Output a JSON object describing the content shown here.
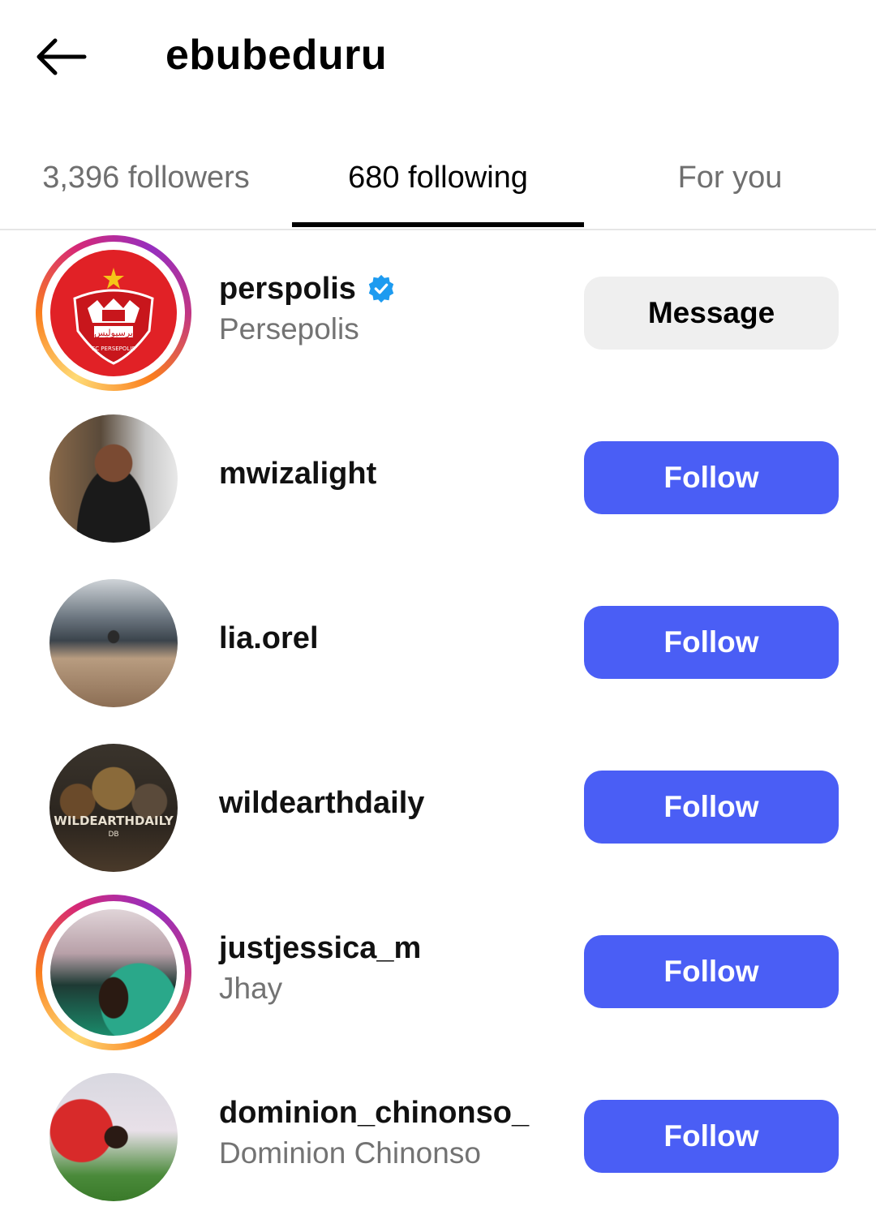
{
  "header": {
    "title": "ebubeduru"
  },
  "tabs": [
    {
      "label": "3,396 followers"
    },
    {
      "label": "680 following"
    },
    {
      "label": "For you"
    }
  ],
  "colors": {
    "follow_button": "#4a5ef5",
    "message_button": "#efefef",
    "verified": "#1d9bf0"
  },
  "users": [
    {
      "username": "perspolis",
      "fullname": "Persepolis",
      "verified": true,
      "button": "Message",
      "story_ring": true,
      "avatar_icon": "persepolis-crest-icon"
    },
    {
      "username": "mwizalight",
      "fullname": "",
      "verified": false,
      "button": "Follow",
      "story_ring": false,
      "avatar_icon": "profile-photo"
    },
    {
      "username": "lia.orel",
      "fullname": "",
      "verified": false,
      "button": "Follow",
      "story_ring": false,
      "avatar_icon": "profile-photo"
    },
    {
      "username": "wildearthdaily",
      "fullname": "",
      "verified": false,
      "button": "Follow",
      "story_ring": false,
      "avatar_icon": "wildearthdaily-logo"
    },
    {
      "username": "justjessica_m",
      "fullname": "Jhay",
      "verified": false,
      "button": "Follow",
      "story_ring": true,
      "avatar_icon": "profile-photo"
    },
    {
      "username": "dominion_chinonso_",
      "fullname": "Dominion Chinonso",
      "verified": false,
      "button": "Follow",
      "story_ring": false,
      "avatar_icon": "profile-photo"
    }
  ],
  "logo_text": {
    "crest_arabic": "پرسپولیس",
    "crest_latin": "FC PERSEPOLIS",
    "wild_logo": "WILDEARTHDAILY",
    "wild_sub": "DB"
  }
}
